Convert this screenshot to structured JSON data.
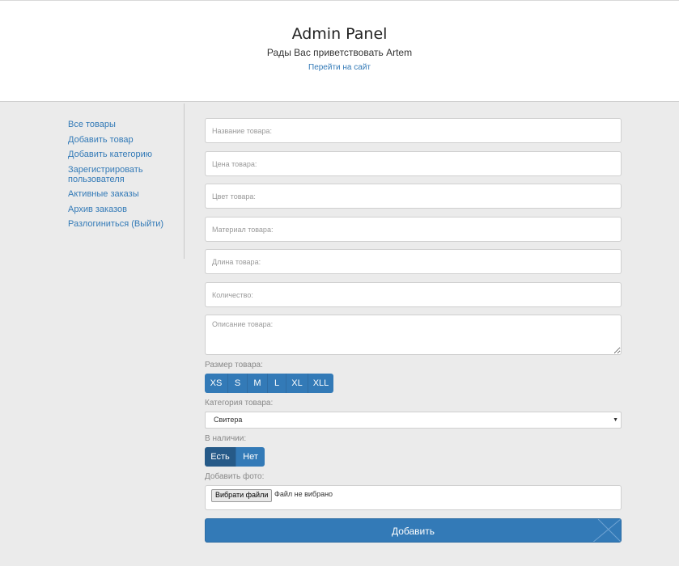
{
  "header": {
    "title": "Admin Panel",
    "welcome": "Рады Вас приветствовать Artem",
    "site_link": "Перейти на сайт"
  },
  "sidebar": {
    "items": [
      {
        "label": "Все товары"
      },
      {
        "label": "Добавить товар"
      },
      {
        "label": "Добавить категорию"
      },
      {
        "label": "Зарегистрировать пользователя"
      },
      {
        "label": "Активные заказы"
      },
      {
        "label": "Архив заказов"
      },
      {
        "label": "Разлогиниться (Выйти)"
      }
    ]
  },
  "form": {
    "name_placeholder": "Название товара:",
    "price_placeholder": "Цена товара:",
    "color_placeholder": "Цвет товара:",
    "material_placeholder": "Материал товара:",
    "length_placeholder": "Длина товара:",
    "quantity_placeholder": "Количество:",
    "description_placeholder": "Описание товара:",
    "size_label": "Размер товара:",
    "sizes": [
      "XS",
      "S",
      "M",
      "L",
      "XL",
      "XLL"
    ],
    "category_label": "Категория товара:",
    "category_selected": "Свитера",
    "stock_label": "В наличии:",
    "stock_options": [
      "Есть",
      "Нет"
    ],
    "stock_selected": "Есть",
    "photo_label": "Добавить фото:",
    "file_button": "Вибрати файли",
    "file_status": "Файл не вибрано",
    "submit_label": "Добавить"
  },
  "colors": {
    "primary": "#337ab7",
    "primary_active": "#265a88",
    "background": "#ebebeb"
  }
}
